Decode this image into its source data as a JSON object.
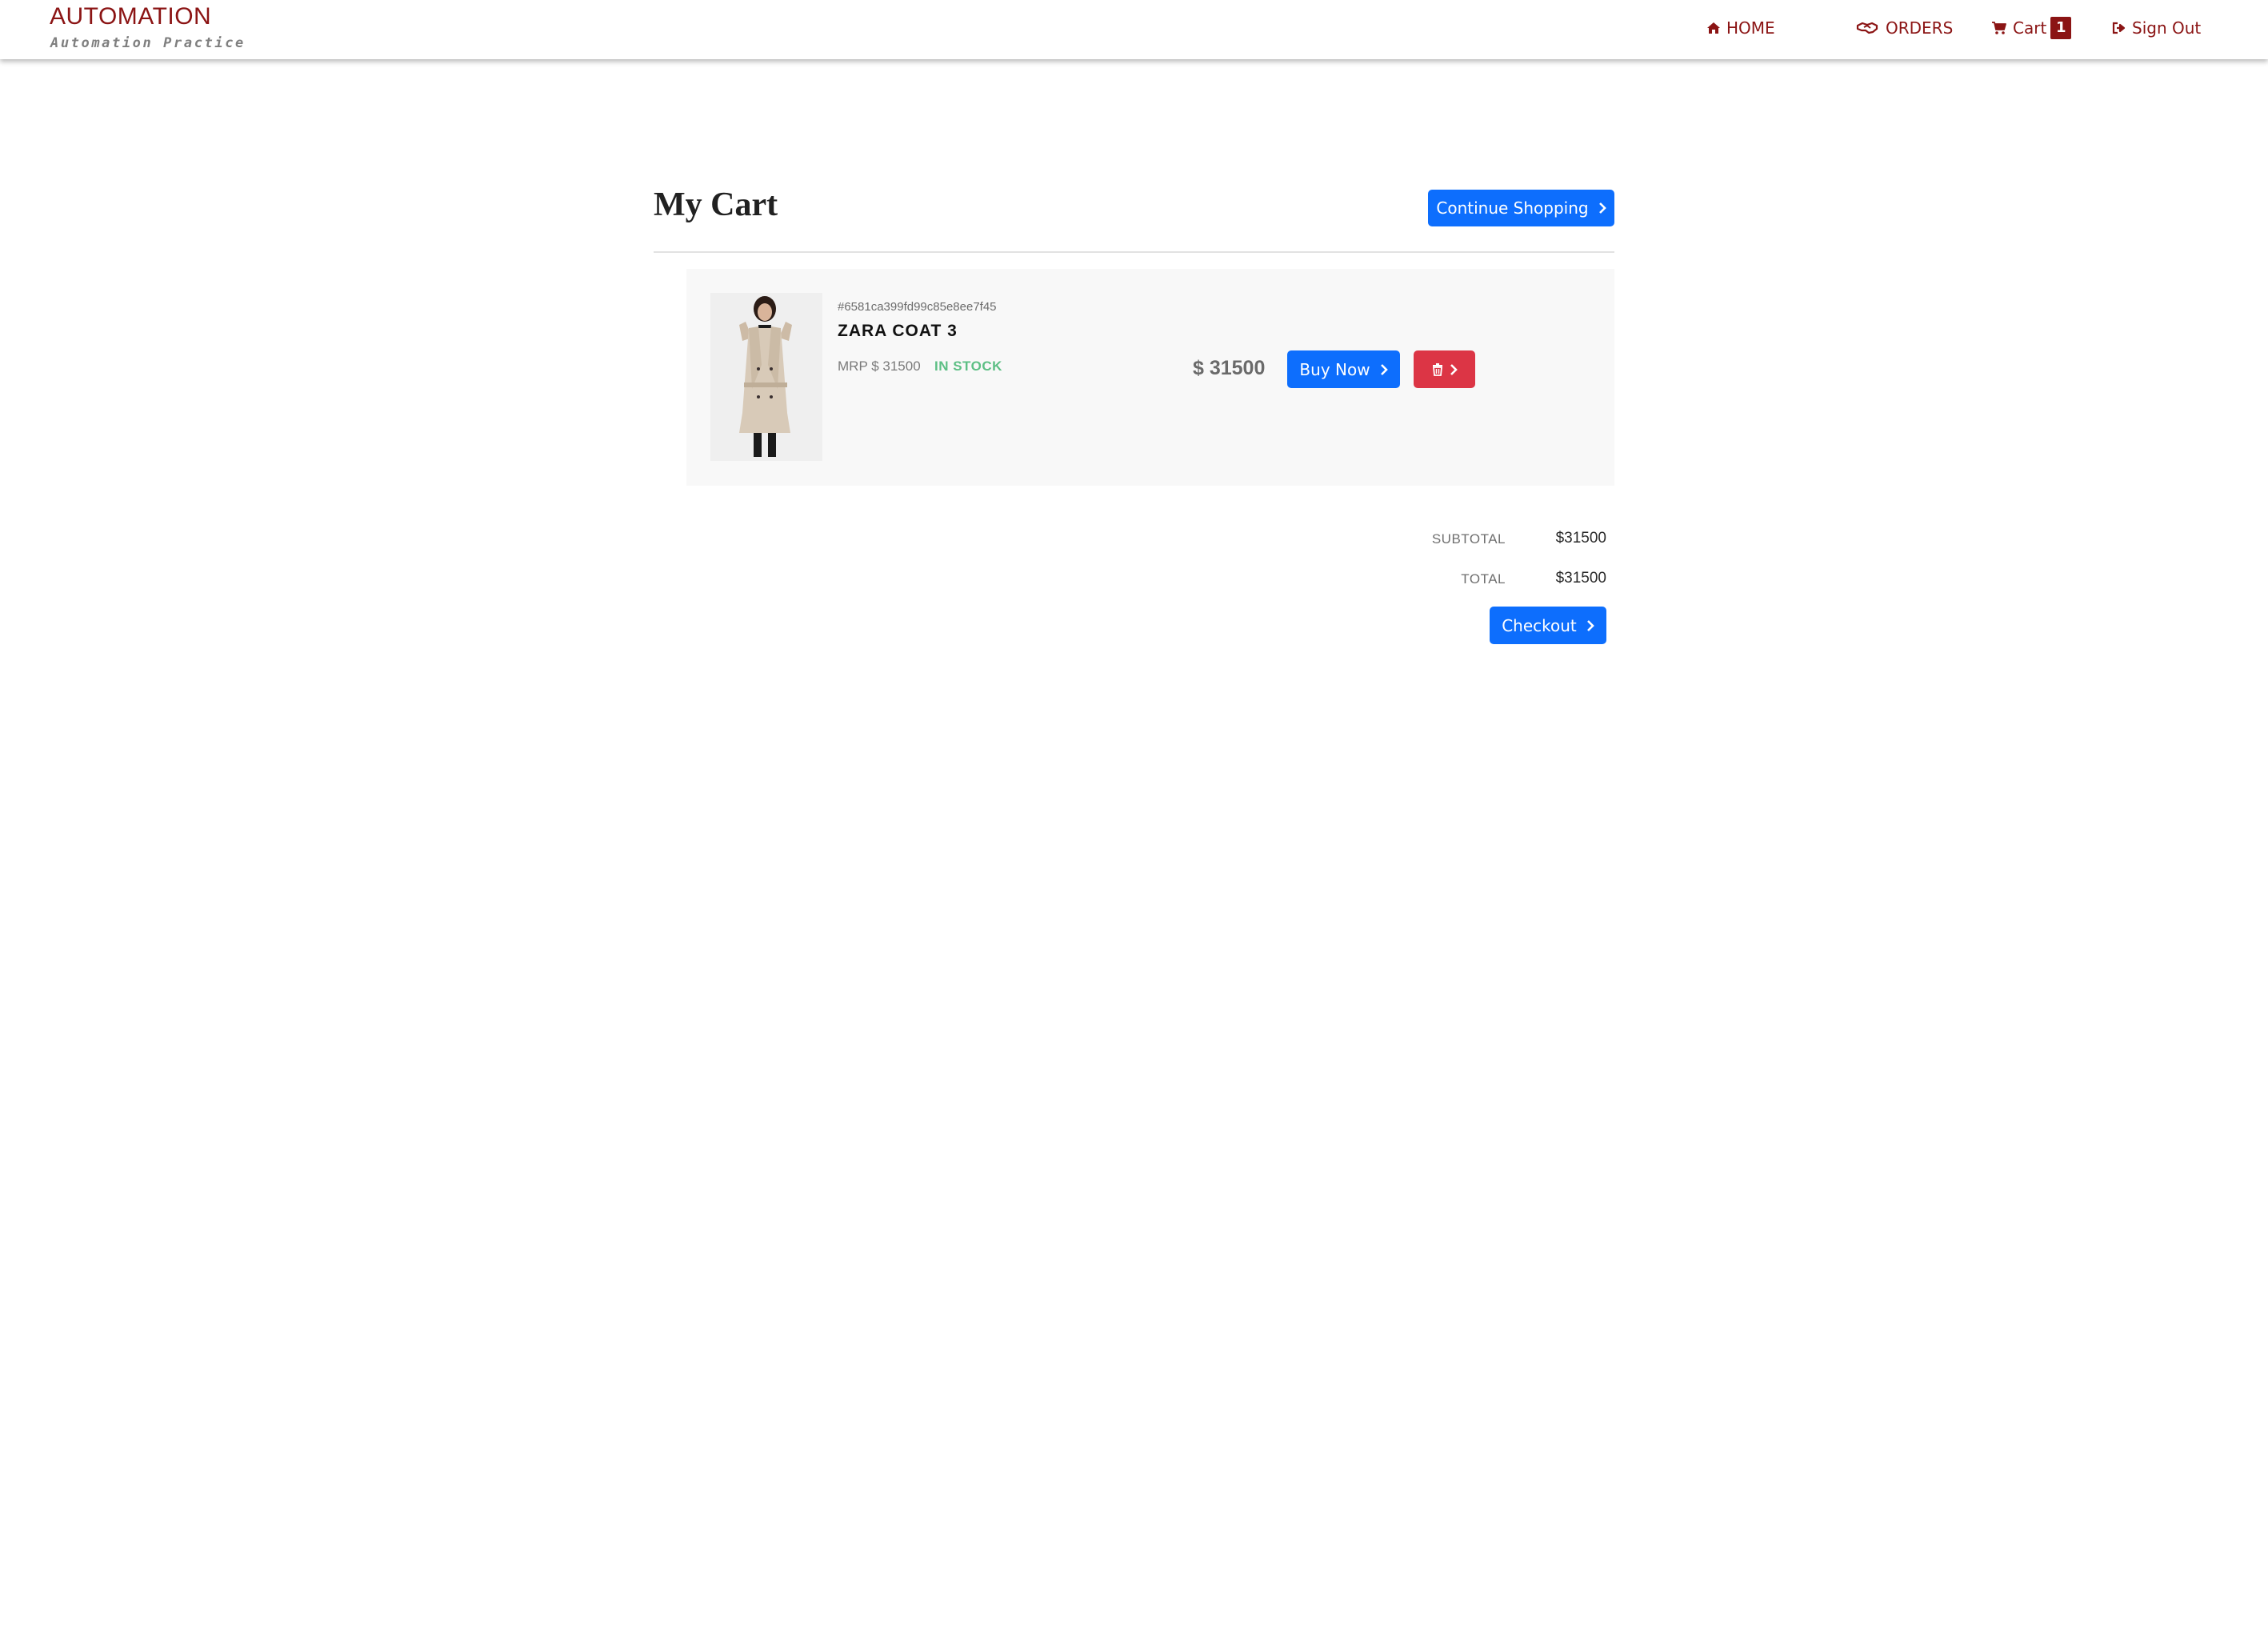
{
  "brand": {
    "title": "AUTOMATION",
    "subtitle": "Automation Practice",
    "color": "#8b1414"
  },
  "nav": {
    "home": {
      "label": "HOME",
      "icon": "home-icon"
    },
    "orders": {
      "label": "ORDERS",
      "icon": "handshake-icon"
    },
    "cart": {
      "label": "Cart",
      "icon": "cart-icon",
      "badge": "1"
    },
    "signout": {
      "label": "Sign Out",
      "icon": "sign-out-icon"
    }
  },
  "cart": {
    "heading": "My Cart",
    "continue_label": "Continue Shopping",
    "items": [
      {
        "id": "#6581ca399fd99c85e8ee7f45",
        "name": "ZARA COAT 3",
        "mrp": "MRP $ 31500",
        "stock": "IN STOCK",
        "price": "$ 31500",
        "buy_label": "Buy Now",
        "image": "zara-coat-product-image",
        "delete_icon": "trash-icon"
      }
    ]
  },
  "summary": {
    "subtotal_label": "SUBTOTAL",
    "subtotal_value": "$31500",
    "total_label": "TOTAL",
    "total_value": "$31500",
    "checkout_label": "Checkout"
  },
  "colors": {
    "primary": "#0d6efd",
    "danger": "#dc3545",
    "in_stock": "#5cbf84",
    "card_bg": "#f8f8f8"
  }
}
